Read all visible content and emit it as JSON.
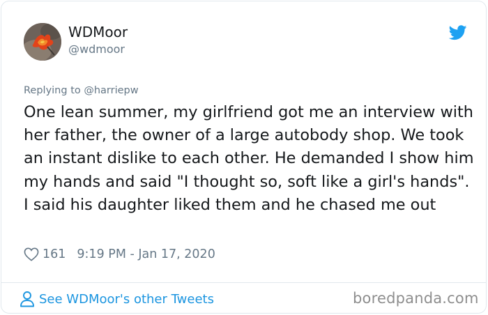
{
  "tweet": {
    "author": {
      "display_name": "WDMoor",
      "handle": "@wdmoor",
      "avatar_icon": "flame-flower-avatar"
    },
    "platform_icon": "twitter-bird-icon",
    "reply_prefix": "Replying to",
    "reply_handle": "@harriepw",
    "text": "One lean summer, my girlfriend got me an interview with her father, the owner of a large autobody shop. We took an instant dislike to each other. He demanded I show him my hands and said \"I thought so, soft like a girl's hands\". I said his daughter liked them and he chased me out",
    "likes": "161",
    "timestamp": "9:19 PM - Jan 17, 2020",
    "see_more_label": "See WDMoor's other Tweets"
  },
  "watermark": "boredpanda.com",
  "colors": {
    "accent": "#1b95e0",
    "muted": "#657786",
    "text": "#14171a",
    "border": "#e1e8ed"
  }
}
